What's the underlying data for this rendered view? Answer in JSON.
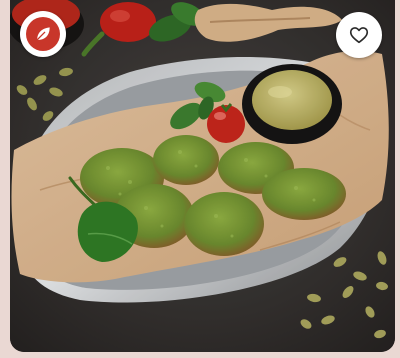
{
  "screen": {
    "background": "#ead8d3",
    "brand_color": "#c8362a"
  },
  "icons": {
    "brand": "leaf-icon",
    "favorite": "heart-outline-icon"
  }
}
